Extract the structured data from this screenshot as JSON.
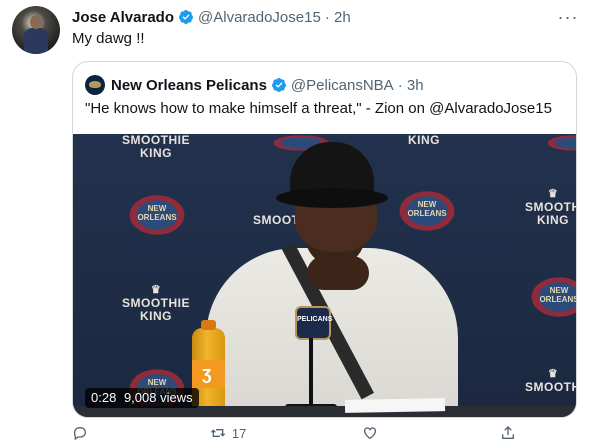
{
  "tweet": {
    "author_name": "Jose Alvarado",
    "author_handle": "@AlvaradoJose15",
    "time": "· 2h",
    "text": "My dawg !!",
    "more": "···"
  },
  "quote": {
    "author_name": "New Orleans Pelicans",
    "author_handle": "@PelicansNBA",
    "time": "· 3h",
    "text": "\"He knows how to make himself a threat,\" - Zion on @AlvaradoJose15"
  },
  "video": {
    "duration": "0:28",
    "views": "9,008 views",
    "backdrop_logo_text": "NEW ORLEANS",
    "sponsor_line1": "SMOOTHIE",
    "sponsor_line2": "KING",
    "mic_flag_text": "PELICANS"
  },
  "actions": [
    {
      "icon": "reply-icon",
      "count": ""
    },
    {
      "icon": "retweet-icon",
      "count": "17"
    },
    {
      "icon": "like-icon",
      "count": ""
    },
    {
      "icon": "share-icon",
      "count": ""
    }
  ],
  "colors": {
    "verified": "#1d9bf0",
    "muted": "#536471",
    "border": "#cfd9de"
  }
}
